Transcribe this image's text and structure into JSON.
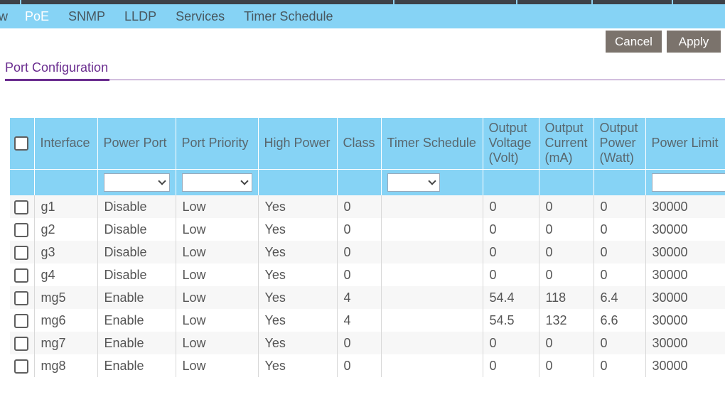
{
  "nav": {
    "items": [
      {
        "label": "w",
        "active": false
      },
      {
        "label": "PoE",
        "active": true
      },
      {
        "label": "SNMP",
        "active": false
      },
      {
        "label": "LLDP",
        "active": false
      },
      {
        "label": "Services",
        "active": false
      },
      {
        "label": "Timer Schedule",
        "active": false
      }
    ]
  },
  "actions": {
    "cancel": "Cancel",
    "apply": "Apply"
  },
  "section": {
    "title": "Port Configuration"
  },
  "table": {
    "headers": [
      "Interface",
      "Power Port",
      "Port Priority",
      "High Power",
      "Class",
      "Timer Schedule",
      "Output Voltage (Volt)",
      "Output Current (mA)",
      "Output Power (Watt)",
      "Power Limit"
    ],
    "rows": [
      [
        "g1",
        "Disable",
        "Low",
        "Yes",
        "0",
        "",
        "0",
        "0",
        "0",
        "30000"
      ],
      [
        "g2",
        "Disable",
        "Low",
        "Yes",
        "0",
        "",
        "0",
        "0",
        "0",
        "30000"
      ],
      [
        "g3",
        "Disable",
        "Low",
        "Yes",
        "0",
        "",
        "0",
        "0",
        "0",
        "30000"
      ],
      [
        "g4",
        "Disable",
        "Low",
        "Yes",
        "0",
        "",
        "0",
        "0",
        "0",
        "30000"
      ],
      [
        "mg5",
        "Enable",
        "Low",
        "Yes",
        "4",
        "",
        "54.4",
        "118",
        "6.4",
        "30000"
      ],
      [
        "mg6",
        "Enable",
        "Low",
        "Yes",
        "4",
        "",
        "54.5",
        "132",
        "6.6",
        "30000"
      ],
      [
        "mg7",
        "Enable",
        "Low",
        "Yes",
        "0",
        "",
        "0",
        "0",
        "0",
        "30000"
      ],
      [
        "mg8",
        "Enable",
        "Low",
        "Yes",
        "0",
        "",
        "0",
        "0",
        "0",
        "30000"
      ]
    ]
  },
  "colors": {
    "nav_bg": "#86d3f5",
    "accent": "#6a2c8f",
    "button_bg": "#7b736c"
  }
}
